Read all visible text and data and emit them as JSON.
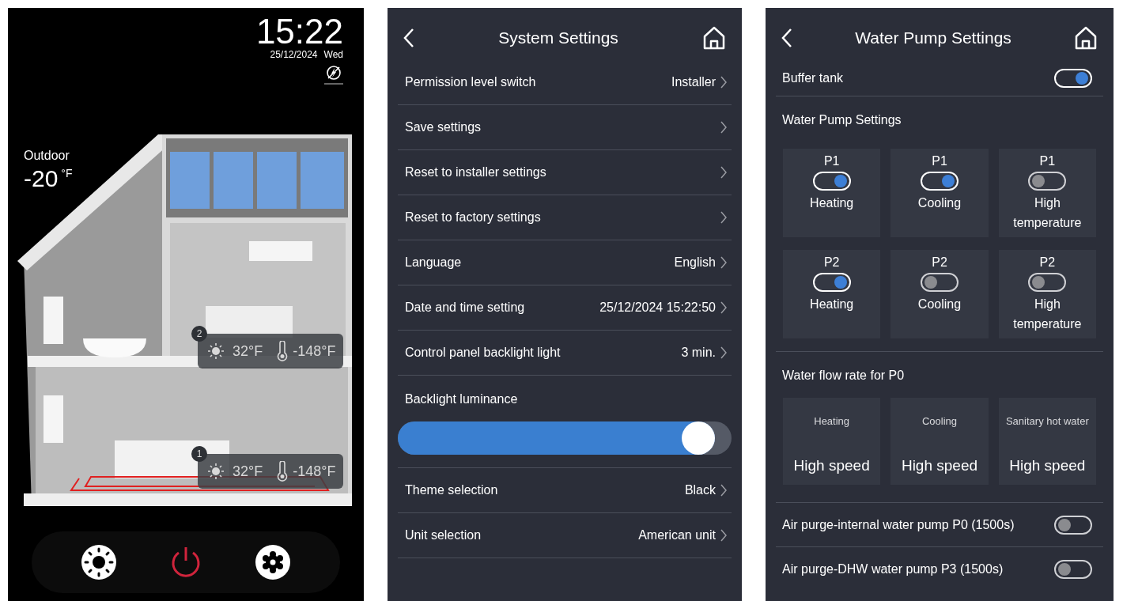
{
  "home_screen": {
    "time": "15:22",
    "date": "25/12/2024",
    "weekday": "Wed",
    "outdoor": {
      "label": "Outdoor",
      "value": "-20",
      "unit": "°F"
    },
    "zones": [
      {
        "number": "2",
        "room_temperature": "32°F",
        "water_temperature": "-148°F"
      },
      {
        "number": "1",
        "room_temperature": "32°F",
        "water_temperature": "-148°F"
      }
    ]
  },
  "system_settings": {
    "title": "System Settings",
    "rows": [
      {
        "kind": "link",
        "label": "Permission level switch",
        "value": "Installer"
      },
      {
        "kind": "link",
        "label": "Save settings"
      },
      {
        "kind": "link",
        "label": "Reset to installer settings"
      },
      {
        "kind": "link",
        "label": "Reset to factory settings"
      },
      {
        "kind": "link",
        "label": "Language",
        "value": "English"
      },
      {
        "kind": "link",
        "label": "Date and time setting",
        "value": "25/12/2024 15:22:50"
      },
      {
        "kind": "link",
        "label": "Control panel backlight light",
        "value": "3 min."
      },
      {
        "kind": "slider",
        "label": "Backlight luminance",
        "level": 0.95
      },
      {
        "kind": "link",
        "label": "Theme selection",
        "value": "Black"
      },
      {
        "kind": "link",
        "label": "Unit selection",
        "value": "American unit"
      }
    ]
  },
  "water_pump_settings": {
    "title": "Water Pump Settings",
    "buffer_tank": {
      "label": "Buffer tank",
      "on": true
    },
    "pump_section": {
      "heading": "Water Pump Settings",
      "switches": [
        {
          "pump": "P1",
          "label": "Heating",
          "on": true
        },
        {
          "pump": "P1",
          "label": "Cooling",
          "on": true
        },
        {
          "pump": "P1",
          "label": "High temperature",
          "on": false
        },
        {
          "pump": "P2",
          "label": "Heating",
          "on": true
        },
        {
          "pump": "P2",
          "label": "Cooling",
          "on": false
        },
        {
          "pump": "P2",
          "label": "High temperature",
          "on": false
        }
      ]
    },
    "flow_section": {
      "heading": "Water flow rate for P0",
      "cards": [
        {
          "mode": "Heating",
          "speed": "High speed"
        },
        {
          "mode": "Cooling",
          "speed": "High speed"
        },
        {
          "mode": "Sanitary hot water",
          "speed": "High speed"
        }
      ]
    },
    "air_purge": [
      {
        "label": "Air purge-internal water pump P0 (1500s)",
        "on": false
      },
      {
        "label": "Air purge-DHW water pump P3 (1500s)",
        "on": false
      }
    ]
  }
}
